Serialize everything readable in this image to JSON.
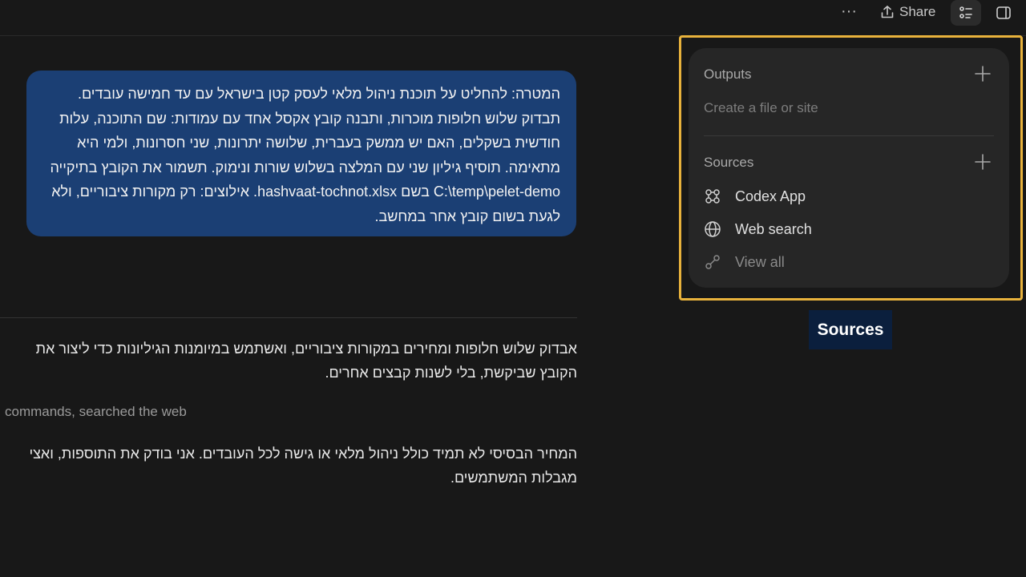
{
  "topbar": {
    "more_icon": "ellipsis-icon",
    "share_label": "Share",
    "list_icon": "list-icon",
    "panel_icon": "sidebar-panel-icon"
  },
  "chat": {
    "user_message": "המטרה: להחליט על תוכנת ניהול מלאי לעסק קטן בישראל עם עד חמישה עובדים. תבדוק שלוש חלופות מוכרות, ותבנה קובץ אקסל אחד עם עמודות: שם התוכנה, עלות חודשית בשקלים, האם יש ממשק בעברית, שלושה יתרונות, שני חסרונות, ולמי היא מתאימה. תוסיף גיליון שני עם המלצה בשלוש שורות ונימוק. תשמור את הקובץ בתיקייה C:\\temp\\pelet-demo בשם hashvaat-tochnot.xlsx. אילוצים: רק מקורות ציבוריים, ולא לגעת בשום קובץ אחר במחשב.",
    "assistant_p1_line1": "אבדוק שלוש חלופות ומחירים במקורות ציבוריים, ואשתמש במיומנות הגיליונות כדי ליצור את",
    "assistant_p1_line2": "הקובץ שביקשת, בלי לשנות קבצים אחרים.",
    "status_line": "commands, searched the web",
    "assistant_p2_line1": "המחיר הבסיסי לא תמיד כולל ניהול מלאי או גישה לכל העובדים. אני בודק את התוספות, ואצי",
    "assistant_p2_line2": "מגבלות המשתמשים."
  },
  "panel": {
    "outputs_title": "Outputs",
    "outputs_hint": "Create a file or site",
    "sources_title": "Sources",
    "items": [
      {
        "label": "Codex App",
        "icon": "command-icon"
      },
      {
        "label": "Web search",
        "icon": "globe-icon"
      },
      {
        "label": "View all",
        "icon": "link-icon"
      }
    ]
  },
  "caption": "Sources",
  "colors": {
    "background": "#181818",
    "user_bubble": "#1b3f74",
    "highlight": "#e8b23c",
    "caption_bg": "#0b1f3d"
  }
}
